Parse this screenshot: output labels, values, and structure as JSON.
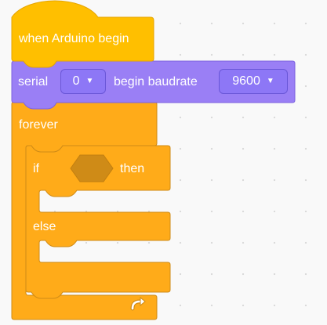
{
  "workspace": {
    "hat_block": {
      "label": "when Arduino begin"
    },
    "serial_block": {
      "label_serial": "serial",
      "port_value": "0",
      "label_begin": "begin baudrate",
      "baud_value": "9600",
      "caret_icon": "caret-down-icon"
    },
    "forever_block": {
      "label": "forever",
      "loop_icon": "loop-arrow-icon"
    },
    "if_block": {
      "label_if": "if",
      "label_then": "then",
      "label_else": "else"
    }
  },
  "colors": {
    "event": "#ffbf00",
    "event_border": "#e6a500",
    "serial": "#9a7ff5",
    "serial_border": "#7d63e0",
    "control": "#ffab19",
    "control_border": "#cf8b17",
    "empty_slot": "#cf8b17",
    "background": "#f9f9f9"
  }
}
